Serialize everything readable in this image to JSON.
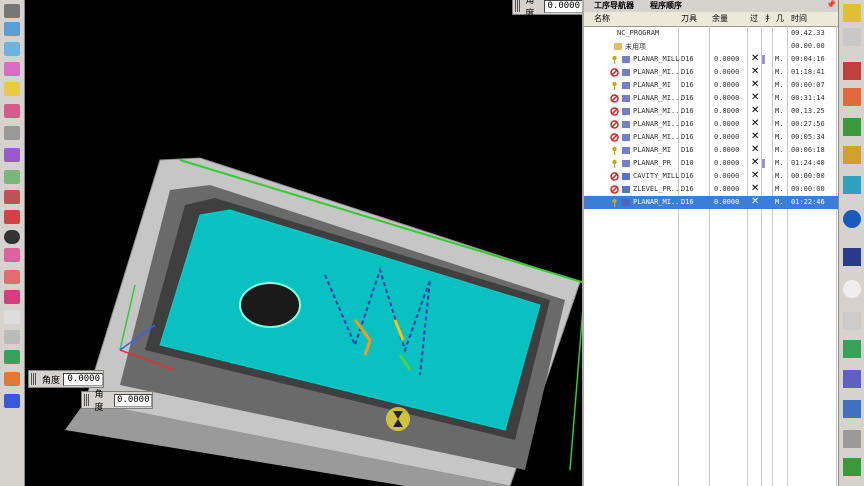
{
  "viewport": {
    "top_dim": {
      "label": "角度",
      "value": "0.0000"
    },
    "dim_left": {
      "label": "角度",
      "value": "0.0000"
    },
    "dim_bottom": {
      "label": "角度",
      "value": "0.0000"
    }
  },
  "navigator": {
    "tabs": [
      "工序导航器",
      "程序顺序"
    ],
    "pin_icon": "pin-icon",
    "headers": {
      "name": "名称",
      "tool": "刀具",
      "stock": "余量",
      "path": "过",
      "ch": "扌",
      "geo": "几",
      "time": "时间"
    },
    "rows": [
      {
        "name": "NC_PROGRAM",
        "tool": "",
        "stock": "",
        "mark": "",
        "geo": "",
        "time": "09.42.33",
        "indent": 0,
        "status": "none",
        "op": "none",
        "x": false,
        "selected": false
      },
      {
        "name": "未用项",
        "tool": "",
        "stock": "",
        "mark": "",
        "geo": "",
        "time": "00.00.00",
        "indent": 1,
        "status": "none",
        "op": "folder",
        "x": false,
        "selected": false
      },
      {
        "name": "PLANAR_MILL",
        "tool": "D16",
        "stock": "0.0000",
        "mark": "|",
        "geo": "M.",
        "time": "00:04:16",
        "indent": 2,
        "status": "key",
        "op": "planar",
        "x": true,
        "selected": false
      },
      {
        "name": "PLANAR_MI...",
        "tool": "D16",
        "stock": "0.0000",
        "mark": "",
        "geo": "M.",
        "time": "01:18:41",
        "indent": 2,
        "status": "no",
        "op": "planar",
        "x": true,
        "selected": false
      },
      {
        "name": "PLANAR_MI",
        "tool": "D16",
        "stock": "0.0000",
        "mark": "",
        "geo": "M.",
        "time": "00:00:07",
        "indent": 2,
        "status": "key",
        "op": "planar",
        "x": true,
        "selected": false
      },
      {
        "name": "PLANAR_MI...",
        "tool": "D16",
        "stock": "0.0000",
        "mark": "",
        "geo": "M.",
        "time": "00:31:14",
        "indent": 2,
        "status": "no",
        "op": "planar",
        "x": true,
        "selected": false
      },
      {
        "name": "PLANAR_MI...",
        "tool": "D16",
        "stock": "0.0000",
        "mark": "",
        "geo": "M.",
        "time": "00.13.25",
        "indent": 2,
        "status": "no",
        "op": "planar",
        "x": true,
        "selected": false
      },
      {
        "name": "PLANAR_MI...",
        "tool": "D16",
        "stock": "0.0000",
        "mark": "",
        "geo": "M.",
        "time": "00:27:56",
        "indent": 2,
        "status": "no",
        "op": "planar",
        "x": true,
        "selected": false
      },
      {
        "name": "PLANAR_MI...",
        "tool": "D16",
        "stock": "0.0000",
        "mark": "",
        "geo": "M.",
        "time": "00:05:34",
        "indent": 2,
        "status": "no",
        "op": "planar",
        "x": true,
        "selected": false
      },
      {
        "name": "PLANAR_MI",
        "tool": "D16",
        "stock": "0.0000",
        "mark": "",
        "geo": "M.",
        "time": "00:06:18",
        "indent": 2,
        "status": "key",
        "op": "planar",
        "x": true,
        "selected": false
      },
      {
        "name": "PLANAR_PR",
        "tool": "D10",
        "stock": "0.0000",
        "mark": "|",
        "geo": "M.",
        "time": "01:24:40",
        "indent": 2,
        "status": "key",
        "op": "planar",
        "x": true,
        "selected": false
      },
      {
        "name": "CAVITY_MILL",
        "tool": "D16",
        "stock": "0.0000",
        "mark": "",
        "geo": "M.",
        "time": "00:00:00",
        "indent": 2,
        "status": "no",
        "op": "cavity",
        "x": true,
        "selected": false
      },
      {
        "name": "ZLEVEL_PR...",
        "tool": "D16",
        "stock": "0.0000",
        "mark": "",
        "geo": "M.",
        "time": "00:00:00",
        "indent": 2,
        "status": "no",
        "op": "zlevel",
        "x": true,
        "selected": false
      },
      {
        "name": "PLANAR_MI...",
        "tool": "D16",
        "stock": "0.0000",
        "mark": "",
        "geo": "M.",
        "time": "01:22:46",
        "indent": 2,
        "status": "key",
        "op": "planar",
        "x": true,
        "selected": true
      }
    ]
  },
  "colors": {
    "toolpath": "#00e5e5",
    "part": "#c8c8c8",
    "selection": "#3a7fd5",
    "edge_green": "#33cc33"
  }
}
